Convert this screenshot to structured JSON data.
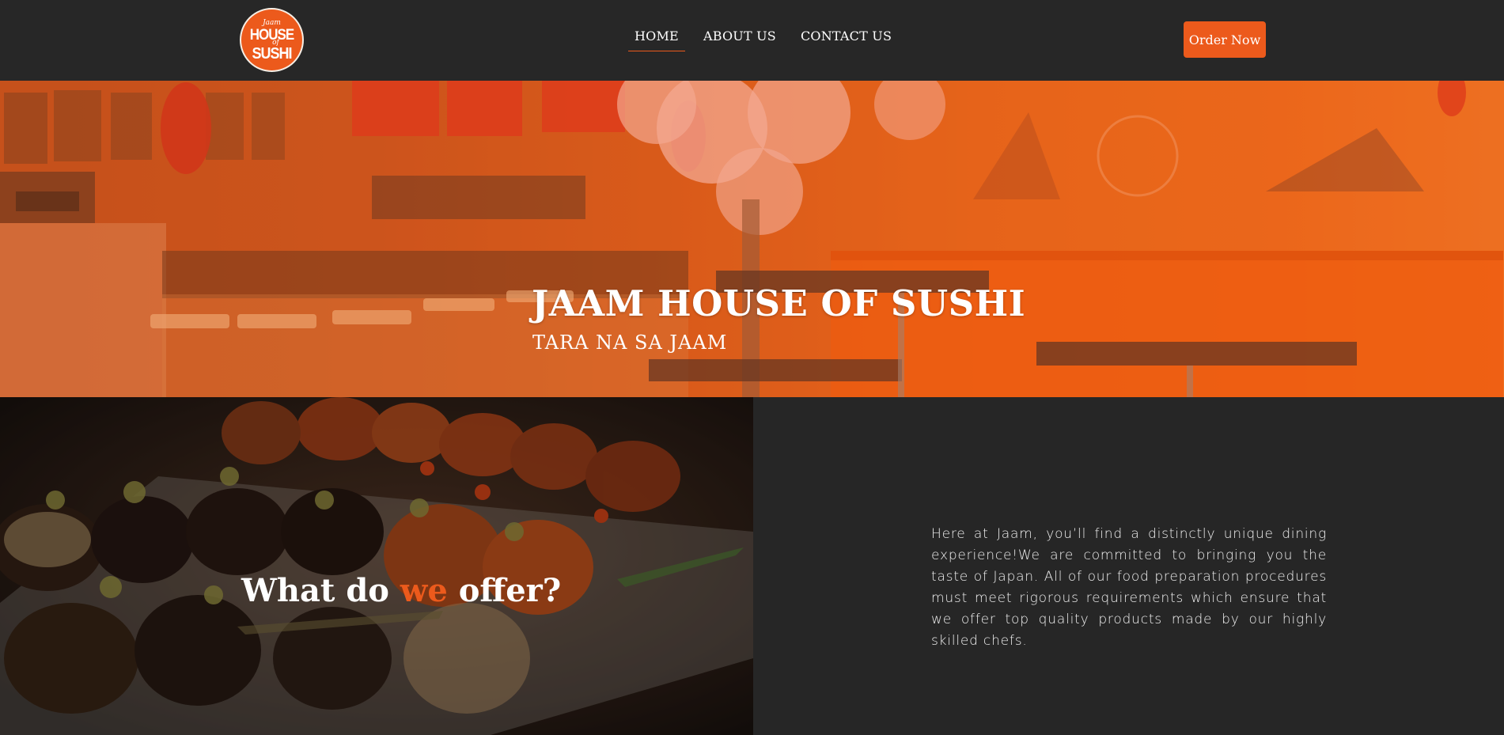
{
  "brand": {
    "logo_text_top": "Jaam",
    "logo_text_mid": "HOUSE",
    "logo_text_of": "of",
    "logo_text_bottom": "SUSHI",
    "accent_color": "#ec5a1c"
  },
  "nav": {
    "items": [
      {
        "label": "HOME",
        "active": true
      },
      {
        "label": "ABOUT US",
        "active": false
      },
      {
        "label": "CONTACT US",
        "active": false
      }
    ],
    "order_label": "Order Now"
  },
  "hero": {
    "title": "JAAM HOUSE OF SUSHI",
    "subtitle": "TARA NA SA JAAM"
  },
  "offer": {
    "title_pre": "What do ",
    "title_accent": "we",
    "title_post": " offer?",
    "description": "Here at Jaam, you’ll find a distinctly unique dining experience!We are committed to bringing you the taste of Japan. All of our food preparation procedures must meet rigorous requirements which ensure that we offer top quality products made by our highly skilled chefs."
  }
}
